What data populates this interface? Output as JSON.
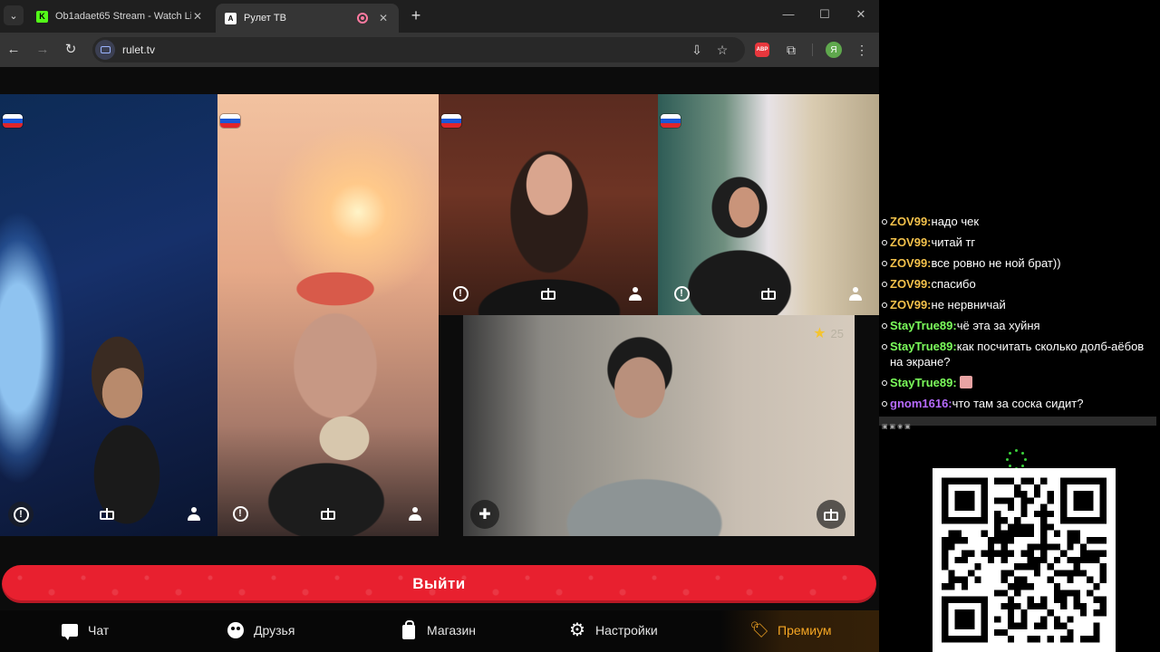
{
  "browser": {
    "tabs": [
      {
        "title": "Ob1adaet65 Stream - Watch Li",
        "favicon": "kick-icon",
        "active": false
      },
      {
        "title": "Рулет ТВ",
        "favicon": "rulet-icon",
        "active": true
      }
    ],
    "url": "rulet.tv",
    "profile_initial": "Я",
    "extension_badge": "ABP"
  },
  "videos": [
    {
      "id": "v1",
      "flag": "RU"
    },
    {
      "id": "v2",
      "flag": "RU"
    },
    {
      "id": "v3",
      "flag": "RU"
    },
    {
      "id": "v4",
      "flag": "RU"
    },
    {
      "id": "v5",
      "stars": "25"
    }
  ],
  "exit_button": {
    "label": "Выйти"
  },
  "bottom_nav": [
    {
      "label": "Чат",
      "icon": "chat-icon"
    },
    {
      "label": "Друзья",
      "icon": "friends-icon"
    },
    {
      "label": "Магазин",
      "icon": "shop-icon"
    },
    {
      "label": "Настройки",
      "icon": "gear-icon"
    },
    {
      "label": "Премиум",
      "icon": "tag-icon"
    }
  ],
  "colors": {
    "exit_red": "#e8202f",
    "premium": "#f5a623",
    "nick_zov": "#f3c14b",
    "nick_staytrue": "#7cff5c",
    "nick_gnom": "#b76bff"
  },
  "chat": [
    {
      "nick": "ZOV99:",
      "text": "надо чек"
    },
    {
      "nick": "ZOV99:",
      "text": "читай тг"
    },
    {
      "nick": "ZOV99:",
      "text": "все ровно не ной брат))"
    },
    {
      "nick": "ZOV99:",
      "text": "спасибо"
    },
    {
      "nick": "ZOV99:",
      "text": "не нервничай"
    },
    {
      "nick": "StayTrue89:",
      "text": "чё эта за хуйня"
    },
    {
      "nick": "StayTrue89:",
      "text": "как посчитать сколько долб-аёбов на экране?"
    },
    {
      "nick": "StayTrue89:",
      "text": ""
    },
    {
      "nick": "gnom1616:",
      "text": "что там за соска сидит?"
    }
  ]
}
